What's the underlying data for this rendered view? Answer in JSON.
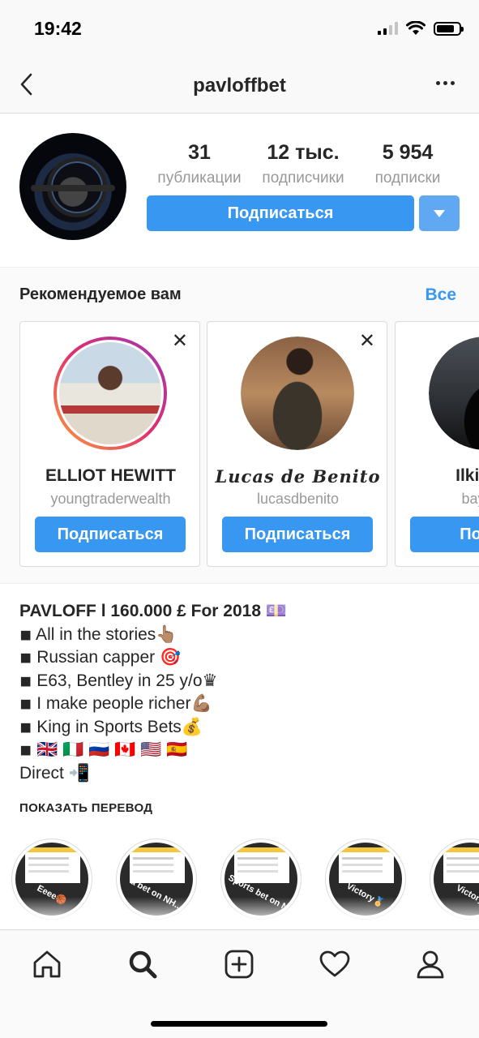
{
  "status_bar": {
    "time": "19:42"
  },
  "header": {
    "username": "pavloffbet"
  },
  "profile": {
    "stats": [
      {
        "value": "31",
        "label": "публикации"
      },
      {
        "value": "12 тыс.",
        "label": "подписчики"
      },
      {
        "value": "5 954",
        "label": "подписки"
      }
    ],
    "follow_label": "Подписаться"
  },
  "suggestions": {
    "title": "Рекомендуемое вам",
    "see_all": "Все",
    "cards": [
      {
        "name": "ELLIOT HEWITT",
        "username": "youngtraderwealth",
        "follow_label": "Подписаться"
      },
      {
        "name": "Lucas de Benito",
        "username": "lucasdbenito",
        "follow_label": "Подписаться"
      },
      {
        "name": "Ilkin Ba",
        "username": "bayram",
        "follow_label": "Подпи"
      }
    ]
  },
  "bio": {
    "name_line": "PAVLOFF l 160.000 £ For 2018 💷",
    "lines": [
      "◾ All in the stories👆🏽",
      "◾ Russian capper 🎯",
      "◾ E63, Bentley in 25 y/o♛",
      "◾ I make people richer💪🏽",
      "◾ King in Sports Bets💰",
      "◾ 🇬🇧 🇮🇹 🇷🇺 🇨🇦 🇺🇸 🇪🇸",
      "Direct 📲"
    ],
    "translate_label": "ПОКАЗАТЬ ПЕРЕВОД"
  },
  "highlights": [
    {
      "label": "Eeee🏀"
    },
    {
      "label": "a bet on NH..."
    },
    {
      "label": "Sports bet on N..."
    },
    {
      "label": "Victory🏅"
    },
    {
      "label": "Victory"
    }
  ],
  "tabs": [
    "home",
    "search",
    "add",
    "activity",
    "profile"
  ],
  "colors": {
    "accent": "#3897f0",
    "secondary_text": "#999999"
  }
}
